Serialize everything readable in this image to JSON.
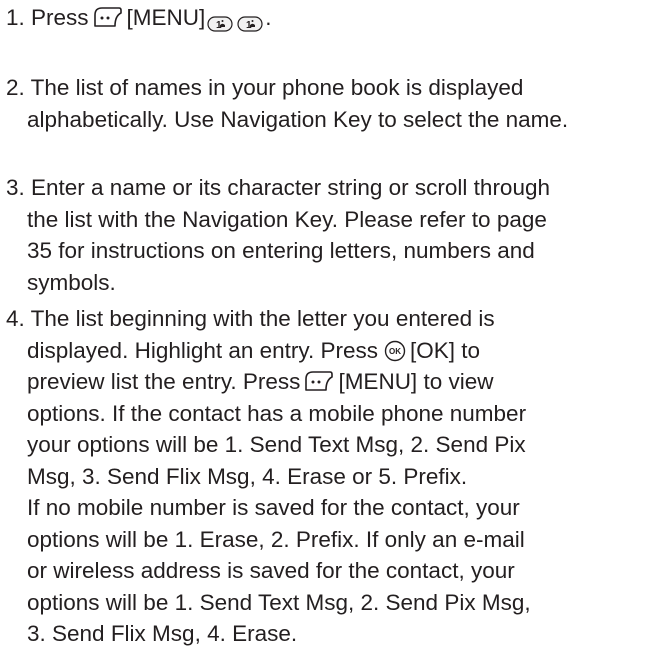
{
  "steps": [
    {
      "lines": [
        "1. Press",
        "[MENU]",
        "."
      ]
    },
    {
      "lines": [
        "2. The list of names in your phone book is displayed",
        "alphabetically. Use Navigation Key to select the name."
      ]
    },
    {
      "lines": [
        "3. Enter a name or its character string or scroll through",
        "the list with the Navigation Key. Please refer to page",
        "35 for instructions on entering letters, numbers and",
        "symbols."
      ]
    },
    {
      "lines": [
        "4. The list beginning with the letter you entered is",
        "displayed. Highlight an entry. Press",
        "[OK] to",
        "preview list the entry. Press",
        "[MENU] to view",
        "options. If the contact has a mobile phone number",
        "your options will be 1. Send Text Msg, 2. Send Pix",
        "Msg, 3. Send Flix Msg, 4. Erase or 5. Prefix.",
        "If no mobile number is saved for the contact, your",
        "options will be 1. Erase, 2. Prefix. If only an e-mail",
        "or wireless address is saved for the contact, your",
        "options will be 1. Send Text Msg, 2. Send Pix Msg,",
        "3. Send Flix Msg, 4. Erase."
      ]
    }
  ],
  "icons": {
    "menu_key": "menu-key-icon",
    "number_key": "number-1-key-icon",
    "ok_key": "ok-key-icon"
  },
  "colors": {
    "text": "#231f20",
    "icon_stroke": "#231f20",
    "icon_fill": "#ffffff",
    "key_fill": "#f2f2f2"
  }
}
